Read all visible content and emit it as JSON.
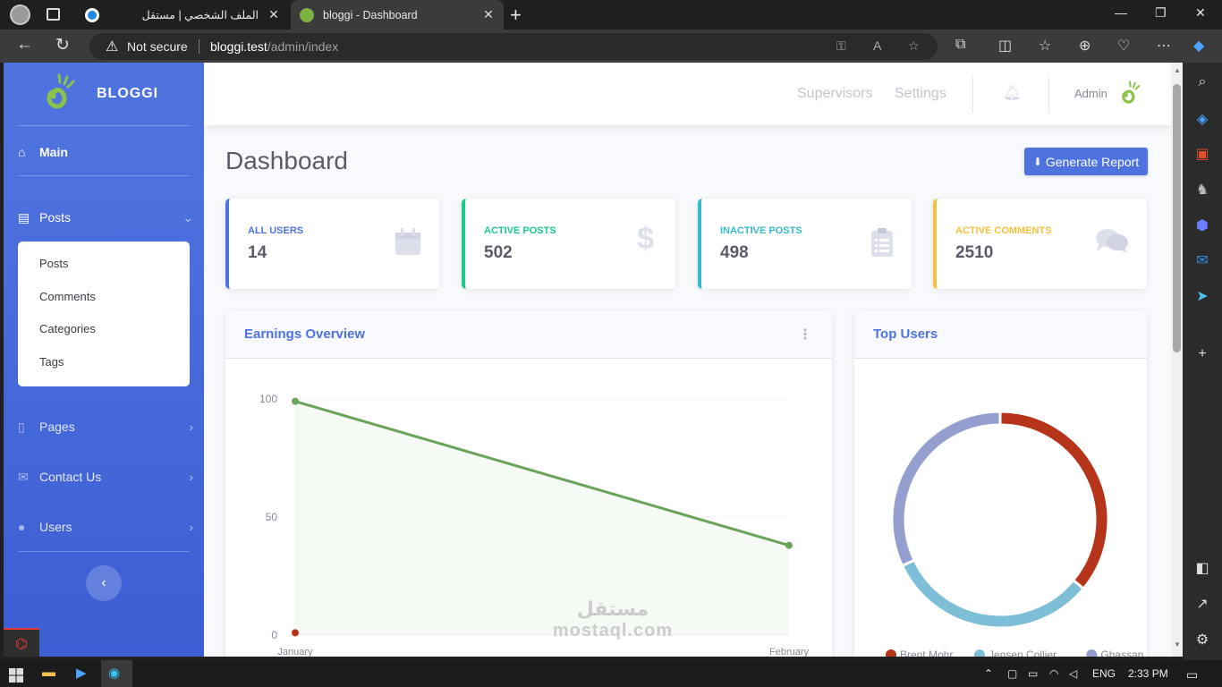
{
  "browser": {
    "tabs": [
      {
        "title": "الملف الشخصي | مستقل",
        "active": false,
        "favicon_color": "#1e88e5"
      },
      {
        "title": "bloggi - Dashboard",
        "active": true,
        "favicon_color": "#7cb342"
      }
    ],
    "security_label": "Not secure",
    "url_host": "bloggi.test",
    "url_path": "/admin/index"
  },
  "sidebar": {
    "brand": "BLOGGI",
    "main_label": "Main",
    "posts_label": "Posts",
    "posts_submenu": [
      "Posts",
      "Comments",
      "Categories",
      "Tags"
    ],
    "items": [
      {
        "label": "Pages",
        "icon": "file-icon"
      },
      {
        "label": "Contact Us",
        "icon": "envelope-icon"
      },
      {
        "label": "Users",
        "icon": "user-icon"
      }
    ],
    "toggle_icon": "chevron-left-icon"
  },
  "topbar": {
    "links": [
      "Supervisors",
      "Settings"
    ],
    "user_name": "Admin"
  },
  "main": {
    "title": "Dashboard",
    "report_button": "Generate Report",
    "cards": [
      {
        "label": "All Users",
        "value": "14",
        "color": "#4e73df",
        "icon": "calendar-icon"
      },
      {
        "label": "Active Posts",
        "value": "502",
        "color": "#1cc88a",
        "icon": "dollar-icon"
      },
      {
        "label": "Inactive Posts",
        "value": "498",
        "color": "#36b9cc",
        "icon": "clipboard-icon"
      },
      {
        "label": "Active Comments",
        "value": "2510",
        "color": "#f6c23e",
        "icon": "comments-icon"
      }
    ],
    "earnings_title": "Earnings Overview",
    "top_users_title": "Top Users"
  },
  "chart_data": [
    {
      "type": "area",
      "title": "Earnings Overview",
      "categories": [
        "January",
        "February"
      ],
      "series": [
        {
          "values": [
            99,
            38
          ],
          "color": "#6aa35a"
        },
        {
          "values": [
            1,
            null
          ],
          "color": "#b5341a"
        }
      ],
      "yticks": [
        0,
        50,
        100
      ],
      "ylim": [
        0,
        100
      ]
    },
    {
      "type": "pie",
      "title": "Top Users",
      "labels": [
        "Brent Mohr",
        "Jensen Collier",
        "Ghassan"
      ],
      "values": [
        36,
        32,
        32
      ],
      "colors": [
        "#b5341a",
        "#7ebfd8",
        "#949fcf"
      ],
      "legend": "bottom"
    }
  ],
  "taskbar": {
    "language": "ENG",
    "time": "2:33 PM"
  },
  "watermark": {
    "line1": "مستقل",
    "line2": "mostaql.com"
  }
}
